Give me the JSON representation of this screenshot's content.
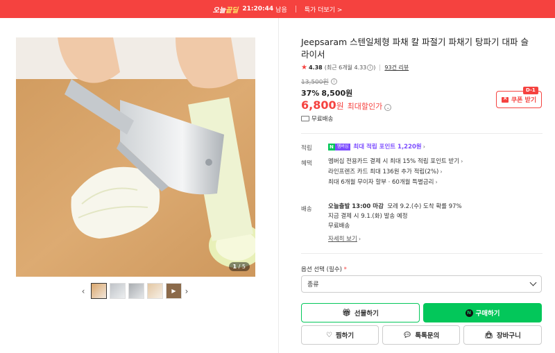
{
  "banner": {
    "brand_prefix": "오늘",
    "brand_highlight": "끝딜",
    "timer": "21:20:44",
    "timer_suffix": "남음",
    "more_label": "특가 더보기 >"
  },
  "gallery": {
    "counter_current": "1",
    "counter_total": "/ 5",
    "thumb_count": 5,
    "prev_icon": "chevron-left-icon",
    "next_icon": "chevron-right-icon"
  },
  "product": {
    "title": "Jeepsaram 스텐일체형 파채 칼 파절기 파채기 탕파기 대파 슬라이서",
    "rating": "4.38",
    "rating_recent": "(최근 6개월 4.33",
    "rating_close": ")",
    "reviews": "93건 리뷰",
    "original_price": "13,500원",
    "discount_percent": "37%",
    "sale_price": "8,500원",
    "final_price": "6,800",
    "final_unit": "원",
    "final_label": "최대할인가",
    "coupon_dday": "D-1",
    "coupon_label": "쿠폰 받기",
    "shipping": "무료배송"
  },
  "rewards": {
    "label": "적립",
    "badge_n": "N",
    "badge_plus": "멤버십",
    "points_text": "최대 적립 포인트 1,220원"
  },
  "benefits": {
    "label": "혜택",
    "lines": [
      "멤버십 전용카드 결제 시 최대 15% 적립 포인트 받기",
      "라인프렌즈 카드 최대 136원 추가 적립(2%)",
      "최대 6개월 무이자 할부 · 60개월 특별금리"
    ]
  },
  "delivery": {
    "label": "배송",
    "line1_bold": "오늘출발 13:00 마감",
    "line1_rest": "모레 9.2.(수) 도착 확률 97%",
    "line2": "지금 결제 시 9.1.(화) 발송 예정",
    "line3": "무료배송",
    "detail_link": "자세히 보기"
  },
  "options": {
    "label": "옵션 선택 (필수)",
    "required_mark": "*",
    "select_value": "종류"
  },
  "actions": {
    "gift": "선물하기",
    "buy": "구매하기",
    "zzim": "찜하기",
    "talk": "톡톡문의",
    "cart": "장바구니"
  },
  "colors": {
    "accent_red": "#f5423f",
    "naver_green": "#03c75a",
    "points_purple": "#7c4dff"
  }
}
